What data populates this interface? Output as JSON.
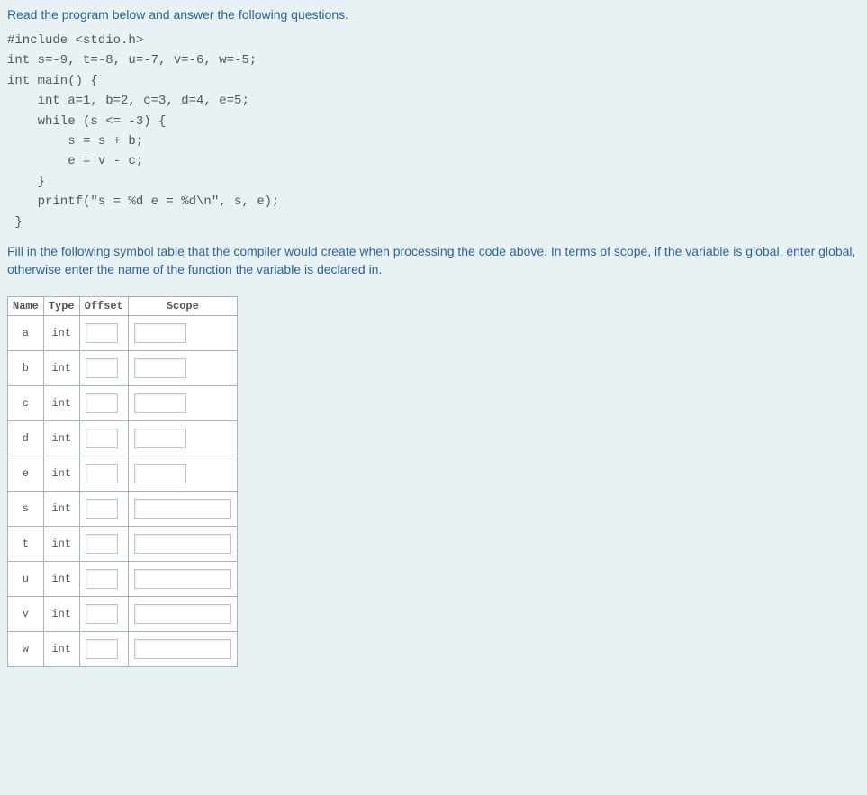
{
  "intro": "Read the program below and answer the following questions.",
  "code": "#include <stdio.h>\nint s=-9, t=-8, u=-7, v=-6, w=-5;\nint main() {\n    int a=1, b=2, c=3, d=4, e=5;\n    while (s <= -3) {\n        s = s + b;\n        e = v - c;\n    }\n    printf(\"s = %d e = %d\\n\", s, e);\n }",
  "instruction": "Fill in the following symbol table that the compiler would create when processing the code above. In terms of scope, if the variable is global, enter global, otherwise enter the name of the function the variable is declared in.",
  "headers": {
    "name": "Name",
    "type": "Type",
    "offset": "Offset",
    "scope": "Scope"
  },
  "rows": [
    {
      "name": "a",
      "type": "int",
      "scopeWide": false
    },
    {
      "name": "b",
      "type": "int",
      "scopeWide": false
    },
    {
      "name": "c",
      "type": "int",
      "scopeWide": false
    },
    {
      "name": "d",
      "type": "int",
      "scopeWide": false
    },
    {
      "name": "e",
      "type": "int",
      "scopeWide": false
    },
    {
      "name": "s",
      "type": "int",
      "scopeWide": true
    },
    {
      "name": "t",
      "type": "int",
      "scopeWide": true
    },
    {
      "name": "u",
      "type": "int",
      "scopeWide": true
    },
    {
      "name": "v",
      "type": "int",
      "scopeWide": true
    },
    {
      "name": "w",
      "type": "int",
      "scopeWide": true
    }
  ]
}
